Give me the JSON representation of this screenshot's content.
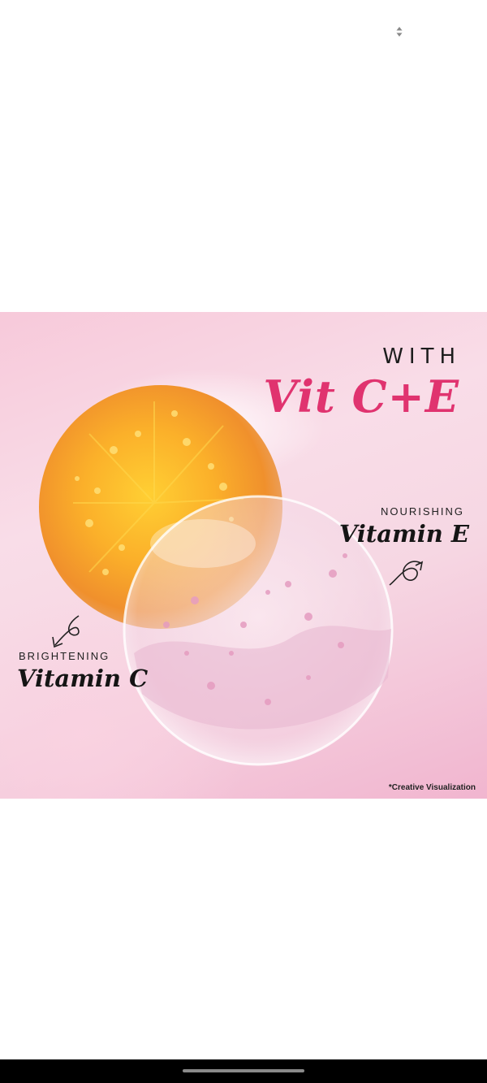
{
  "header": {
    "sort_icon": "sort-up-down-icon"
  },
  "promo": {
    "with_text": "WITH",
    "title": "Vit C+E",
    "nourish_label": "NOURISHING",
    "vitamin_e": "Vitamin E",
    "bright_label": "BRIGHTENING",
    "vitamin_c": "Vitamin C",
    "disclaimer": "*Creative Visualization",
    "colors": {
      "accent": "#e0336f",
      "orange_sphere": "#f5a623",
      "background_pink": "#f7c9da"
    }
  },
  "system_nav": {
    "home_indicator": "home-indicator"
  }
}
